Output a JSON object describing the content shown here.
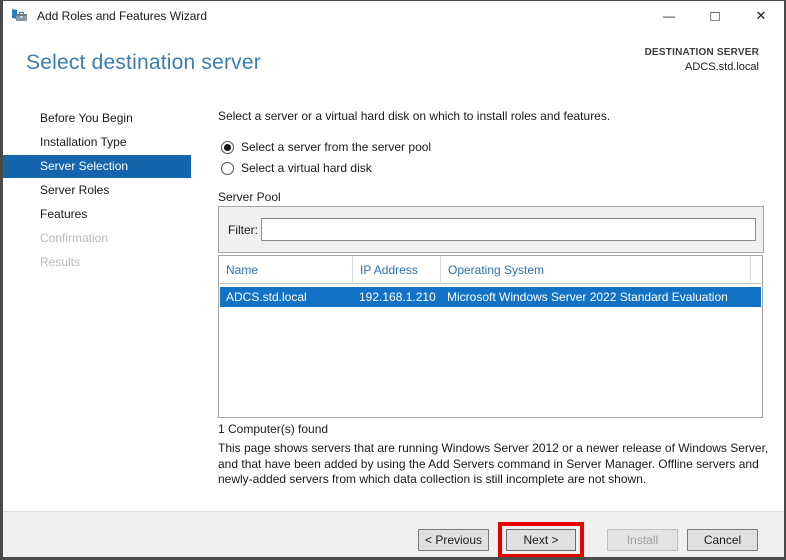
{
  "window": {
    "title": "Add Roles and Features Wizard"
  },
  "icons": {
    "minimize": "—",
    "maximize": "□",
    "close": "✕"
  },
  "header": {
    "title": "Select destination server",
    "destination_label": "DESTINATION SERVER",
    "destination_value": "ADCS.std.local"
  },
  "sidebar": {
    "items": [
      {
        "label": "Before You Begin",
        "state": "normal"
      },
      {
        "label": "Installation Type",
        "state": "normal"
      },
      {
        "label": "Server Selection",
        "state": "selected"
      },
      {
        "label": "Server Roles",
        "state": "normal"
      },
      {
        "label": "Features",
        "state": "normal"
      },
      {
        "label": "Confirmation",
        "state": "disabled"
      },
      {
        "label": "Results",
        "state": "disabled"
      }
    ]
  },
  "main": {
    "instruction": "Select a server or a virtual hard disk on which to install roles and features.",
    "radios": [
      {
        "label": "Select a server from the server pool",
        "selected": true
      },
      {
        "label": "Select a virtual hard disk",
        "selected": false
      }
    ],
    "server_pool": {
      "title": "Server Pool",
      "filter_label": "Filter:",
      "filter_value": "",
      "table": {
        "columns": [
          "Name",
          "IP Address",
          "Operating System"
        ],
        "rows": [
          {
            "name": "ADCS.std.local",
            "ip": "192.168.1.210",
            "os": "Microsoft Windows Server 2022 Standard Evaluation",
            "selected": true
          }
        ]
      },
      "count_text": "1 Computer(s) found"
    },
    "description": "This page shows servers that are running Windows Server 2012 or a newer release of Windows Server, and that have been added by using the Add Servers command in Server Manager. Offline servers and newly-added servers from which data collection is still incomplete are not shown."
  },
  "footer": {
    "buttons": [
      {
        "label": "< Previous",
        "enabled": true,
        "highlighted": false
      },
      {
        "label": "Next >",
        "enabled": true,
        "highlighted": true
      },
      {
        "label": "Install",
        "enabled": false,
        "highlighted": false
      },
      {
        "label": "Cancel",
        "enabled": true,
        "highlighted": false
      }
    ]
  },
  "colors": {
    "sidebar_selection": "#1565ad",
    "row_selection": "#1273c6",
    "header_title_blue": "#3b7db0",
    "table_header_text": "#2d71ae",
    "annotation_red": "#e60000"
  }
}
